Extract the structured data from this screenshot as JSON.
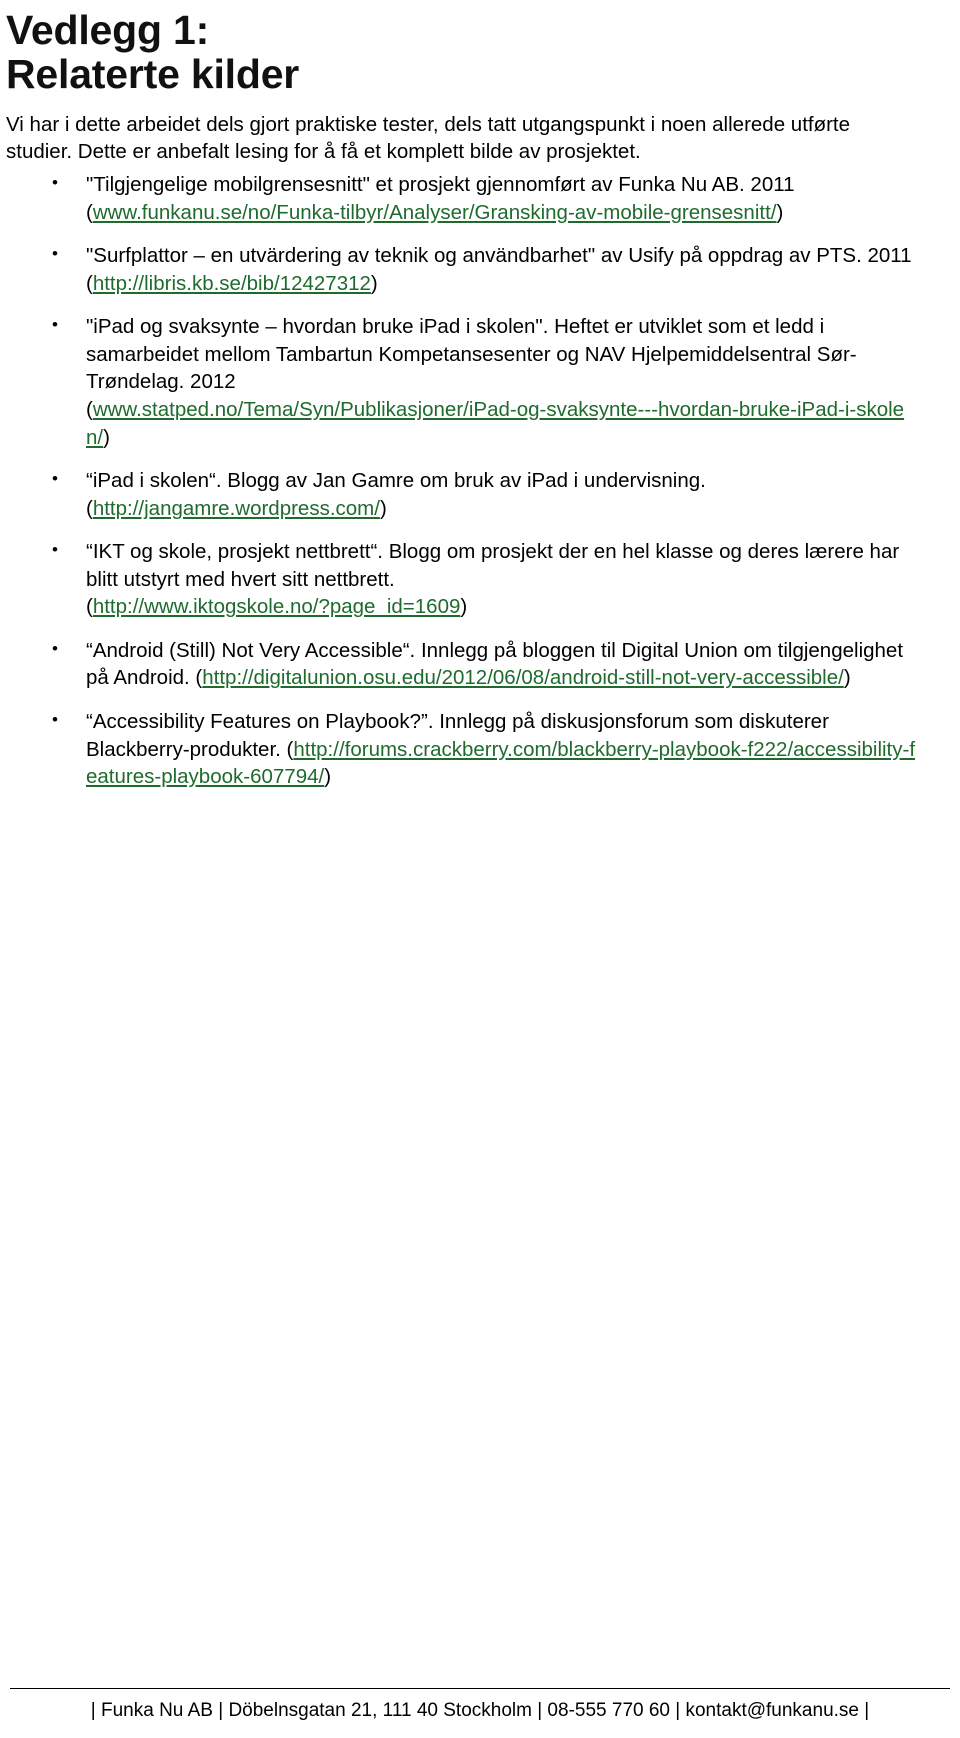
{
  "document": {
    "title_line_1": "Vedlegg 1:",
    "title_line_2": "Relaterte kilder",
    "intro": "Vi har i dette arbeidet dels gjort praktiske tester, dels tatt utgangspunkt i noen allerede utførte studier. Dette er anbefalt lesing for å få et komplett bilde av prosjektet."
  },
  "sources": [
    {
      "text": "\"Tilgjengelige mobilgrensesnitt\" et prosjekt gjennomført av Funka Nu AB. 2011",
      "link": "www.funkanu.se/no/Funka-tilbyr/Analyser/Gransking-av-mobile-grensesnitt/",
      "link_inline": false
    },
    {
      "text": "\"Surfplattor – en utvärdering av teknik og användbarhet\" av Usify på oppdrag av PTS. 2011",
      "link": "http://libris.kb.se/bib/12427312",
      "link_inline": false
    },
    {
      "text": "\"iPad og svaksynte – hvordan bruke iPad i skolen\". Heftet er utviklet som et ledd i samarbeidet mellom Tambartun Kompetansesenter og NAV Hjelpemiddelsentral Sør-Trøndelag. 2012",
      "link": "www.statped.no/Tema/Syn/Publikasjoner/iPad-og-svaksynte---hvordan-bruke-iPad-i-skolen/",
      "link_inline": false
    },
    {
      "text": "“iPad i skolen“. Blogg av Jan Gamre om bruk av iPad i undervisning.",
      "link": "http://jangamre.wordpress.com/",
      "link_inline": false
    },
    {
      "text": "“IKT og skole, prosjekt nettbrett“. Blogg om prosjekt der en hel klasse og deres lærere har blitt utstyrt med hvert sitt nettbrett.",
      "link": "http://www.iktogskole.no/?page_id=1609",
      "link_inline": false
    },
    {
      "text": "“Android (Still) Not Very Accessible“. Innlegg på bloggen til Digital Union om tilgjengelighet på Android. ",
      "link": "http://digitalunion.osu.edu/2012/06/08/android-still-not-very-accessible/",
      "link_inline": true
    },
    {
      "text": "“Accessibility Features on Playbook?”. Innlegg på diskusjonsforum som diskuterer Blackberry-produkter. ",
      "link": "http://forums.crackberry.com/blackberry-playbook-f222/accessibility-features-playbook-607794/",
      "link_inline": true
    }
  ],
  "footer": {
    "text": "| Funka Nu AB | Döbelnsgatan 21, 111 40 Stockholm | 08-555 770 60 | kontakt@funkanu.se |"
  },
  "colors": {
    "link": "#1F6B2E",
    "text": "#000000",
    "background": "#FFFFFF"
  }
}
